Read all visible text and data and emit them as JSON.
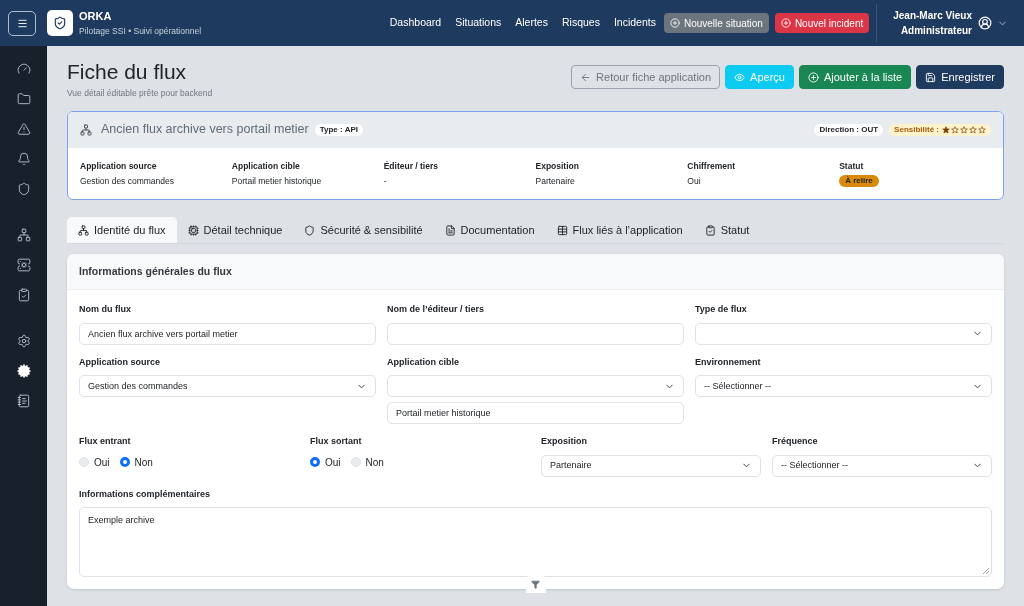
{
  "header": {
    "brand": "ORKA",
    "subtitle": "Pilotage SSI • Suivi opérationnel",
    "nav": [
      "Dashboard",
      "Situations",
      "Alertes",
      "Risques",
      "Incidents"
    ],
    "actions": [
      {
        "label": "Nouvelle situation",
        "kind": "secondary"
      },
      {
        "label": "Nouvel incident",
        "kind": "danger"
      }
    ],
    "user": {
      "name": "Jean-Marc Vieux",
      "role": "Administrateur"
    }
  },
  "sidebar": {
    "groups": [
      {
        "items": [
          {
            "selected": false
          },
          {
            "selected": false
          },
          {
            "selected": false
          },
          {
            "selected": false
          },
          {
            "selected": false
          }
        ]
      },
      {
        "items": [
          {
            "selected": false
          },
          {
            "selected": false
          },
          {
            "selected": false
          }
        ]
      },
      {
        "items": [
          {
            "selected": false
          },
          {
            "selected": true
          },
          {
            "selected": false
          }
        ]
      }
    ]
  },
  "page": {
    "title": "Fiche du flux",
    "subtitle": "Vue détail éditable prête pour backend",
    "actions": [
      {
        "label": "Retour fiche application",
        "kind": "outline"
      },
      {
        "label": "Aperçu",
        "kind": "info"
      },
      {
        "label": "Ajouter à la liste",
        "kind": "success"
      },
      {
        "label": "Enregistrer",
        "kind": "primary"
      }
    ]
  },
  "summary": {
    "title": "Ancien flux archive vers portail metier",
    "type": "Type : API",
    "direction": "Direction : OUT",
    "sensitivity": {
      "label": "Sensibilité :",
      "stars": 1
    },
    "fields": [
      {
        "label": "Application source",
        "value": "Gestion des commandes",
        "kind": "text"
      },
      {
        "label": "Application cible",
        "value": "Portail metier historique",
        "kind": "text"
      },
      {
        "label": "Éditeur / tiers",
        "value": "-",
        "kind": "text"
      },
      {
        "label": "Exposition",
        "value": "Partenaire",
        "kind": "text"
      },
      {
        "label": "Chiffrement",
        "value": "Oui",
        "kind": "text"
      },
      {
        "label": "Statut",
        "value": "À relire",
        "kind": "badge",
        "color": "#d98a0b"
      }
    ]
  },
  "tabs": [
    {
      "label": "Identité du flux",
      "selected": true
    },
    {
      "label": "Détail technique",
      "selected": false
    },
    {
      "label": "Sécurité & sensibilité",
      "selected": false
    },
    {
      "label": "Documentation",
      "selected": false
    },
    {
      "label": "Flux liés à l’application",
      "selected": false
    },
    {
      "label": "Statut",
      "selected": false
    }
  ],
  "form": {
    "title": "Informations générales du flux",
    "rows": [
      {
        "fields": [
          {
            "kind": "text",
            "label": "Nom du flux",
            "value": "Ancien flux archive vers portail metier"
          },
          {
            "kind": "text",
            "label": "Nom de l’éditeur / tiers"
          },
          {
            "kind": "select",
            "label": "Type de flux"
          }
        ]
      },
      {
        "fields": [
          {
            "kind": "select",
            "label": "Application source",
            "value": "Gestion des commandes"
          },
          {
            "kind": "select",
            "label": "Application cible",
            "extra": "Portail metier historique"
          },
          {
            "kind": "select",
            "label": "Environnement",
            "value": "-- Sélectionner --"
          }
        ]
      },
      {
        "fields": [
          {
            "kind": "radio",
            "label": "Flux entrant",
            "options": [
              {
                "label": "Oui",
                "selected": false
              },
              {
                "label": "Non",
                "selected": true
              }
            ]
          },
          {
            "kind": "radio",
            "label": "Flux sortant",
            "options": [
              {
                "label": "Oui",
                "selected": true
              },
              {
                "label": "Non",
                "selected": false
              }
            ]
          },
          {
            "kind": "select",
            "label": "Exposition",
            "value": "Partenaire"
          },
          {
            "kind": "select",
            "label": "Fréquence",
            "value": "-- Sélectionner --"
          }
        ]
      },
      {
        "fields": [
          {
            "kind": "textarea",
            "label": "Informations complémentaires",
            "value": "Exemple archive"
          }
        ]
      }
    ]
  }
}
